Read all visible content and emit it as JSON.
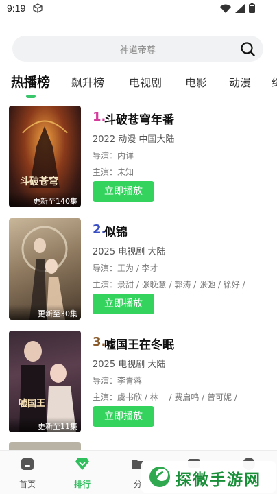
{
  "status_bar": {
    "time": "9:19"
  },
  "search": {
    "placeholder": "神道帝尊"
  },
  "tabs": [
    {
      "label": "热播榜",
      "active": true
    },
    {
      "label": "飙升榜"
    },
    {
      "label": "电视剧"
    },
    {
      "label": "电影"
    },
    {
      "label": "动漫"
    },
    {
      "label": "综"
    }
  ],
  "items": [
    {
      "rank": "1.",
      "rank_color": "#d63a9b",
      "title": "斗破苍穹年番",
      "meta": "2022  动漫  中国大陆",
      "director": "导演：内详",
      "cast": "主演：未知",
      "badge": "更新至140集",
      "play_label": "立即播放"
    },
    {
      "rank": "2.",
      "rank_color": "#3a4fc4",
      "title": "似锦",
      "meta": "2025  电视剧  大陆",
      "director": "导演：王为 / 李才",
      "cast": "主演：景甜 / 张晚意 / 郭涛 / 张弛 / 徐好 / ",
      "badge": "更新至30集",
      "play_label": "立即播放"
    },
    {
      "rank": "3.",
      "rank_color": "#8a5a2b",
      "title": "嘘国王在冬眠",
      "meta": "2025  电视剧  大陆",
      "director": "导演：李青蓉",
      "cast": "主演：虞书欣 / 林一 / 费启鸣 / 曾可妮 / ",
      "badge": "更新至11集",
      "play_label": "立即播放"
    }
  ],
  "bottom_nav": [
    {
      "label": "首页",
      "icon": "home-icon"
    },
    {
      "label": "排行",
      "icon": "rank-icon",
      "active": true
    },
    {
      "label": "分",
      "icon": "category-icon"
    },
    {
      "label": "",
      "icon": "tv-icon"
    },
    {
      "label": "",
      "icon": "user-icon"
    }
  ],
  "watermark": {
    "text": "探微手游网"
  },
  "colors": {
    "accent": "#33d35e",
    "active_tab_indicator": "#39c66b"
  }
}
